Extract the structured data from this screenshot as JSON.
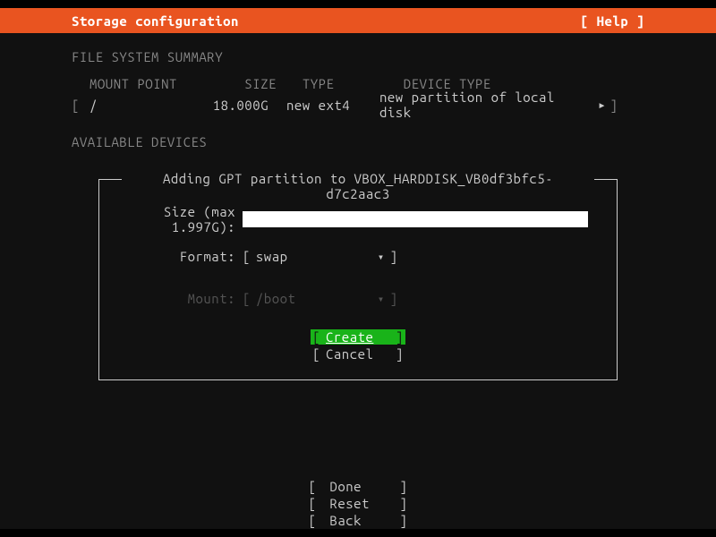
{
  "header": {
    "title": "Storage configuration",
    "help": "[ Help ]"
  },
  "fs_summary": {
    "heading": "FILE SYSTEM SUMMARY",
    "columns": {
      "mount": "MOUNT POINT",
      "size": "SIZE",
      "type": "TYPE",
      "devtype": "DEVICE TYPE"
    },
    "row": {
      "open": "[",
      "mount": "/",
      "size": "18.000G",
      "type": "new ext4",
      "devtype": "new partition of local disk",
      "arrow": "▸",
      "close": "]"
    }
  },
  "available": {
    "heading": "AVAILABLE DEVICES"
  },
  "dialog": {
    "title": "Adding GPT partition to VBOX_HARDDISK_VB0df3bfc5-d7c2aac3",
    "size_label": "Size (max 1.997G):",
    "size_value": "",
    "format_label": "Format:",
    "format_value": "swap",
    "mount_label": "Mount:",
    "mount_value": "/boot",
    "caret": "▾",
    "bracket_open": "[",
    "bracket_close": "]",
    "create_label": "Create",
    "cancel_label": "Cancel"
  },
  "footer": {
    "done": "Done",
    "reset": "Reset",
    "back": "Back"
  }
}
